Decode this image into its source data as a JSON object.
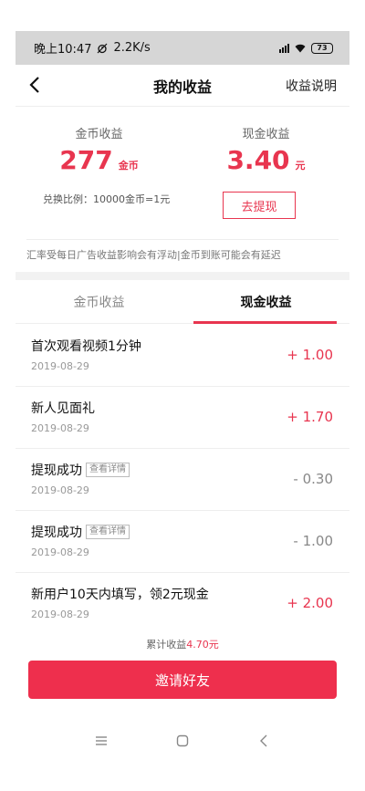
{
  "status_bar": {
    "time": "晚上10:47",
    "speed": "2.2K/s",
    "battery": "73"
  },
  "header": {
    "title": "我的收益",
    "right_link": "收益说明"
  },
  "summary": {
    "coin_label": "金币收益",
    "coin_amount": "277",
    "coin_unit": "金币",
    "cash_label": "现金收益",
    "cash_amount": "3.40",
    "cash_unit": "元",
    "exchange_ratio": "兑换比例：10000金币=1元",
    "withdraw_button": "去提现",
    "notice": "汇率受每日广告收益影响会有浮动|金币到账可能会有延迟"
  },
  "tabs": [
    {
      "label": "金币收益",
      "active": false
    },
    {
      "label": "现金收益",
      "active": true
    }
  ],
  "records": [
    {
      "title": "首次观看视频1分钟",
      "date": "2019-08-29",
      "amount": "+ 1.00",
      "detail": ""
    },
    {
      "title": "新人见面礼",
      "date": "2019-08-29",
      "amount": "+ 1.70",
      "detail": ""
    },
    {
      "title": "提现成功",
      "date": "2019-08-29",
      "amount": "- 0.30",
      "detail": "查看详情"
    },
    {
      "title": "提现成功",
      "date": "2019-08-29",
      "amount": "- 1.00",
      "detail": "查看详情"
    },
    {
      "title": "新用户10天内填写，领2元现金",
      "date": "2019-08-29",
      "amount": "+ 2.00",
      "detail": ""
    }
  ],
  "total": {
    "label": "累计收益",
    "value": "4.70元"
  },
  "invite_button": "邀请好友",
  "colors": {
    "accent": "#e8354f",
    "status_bar": "#d6d6d6"
  }
}
